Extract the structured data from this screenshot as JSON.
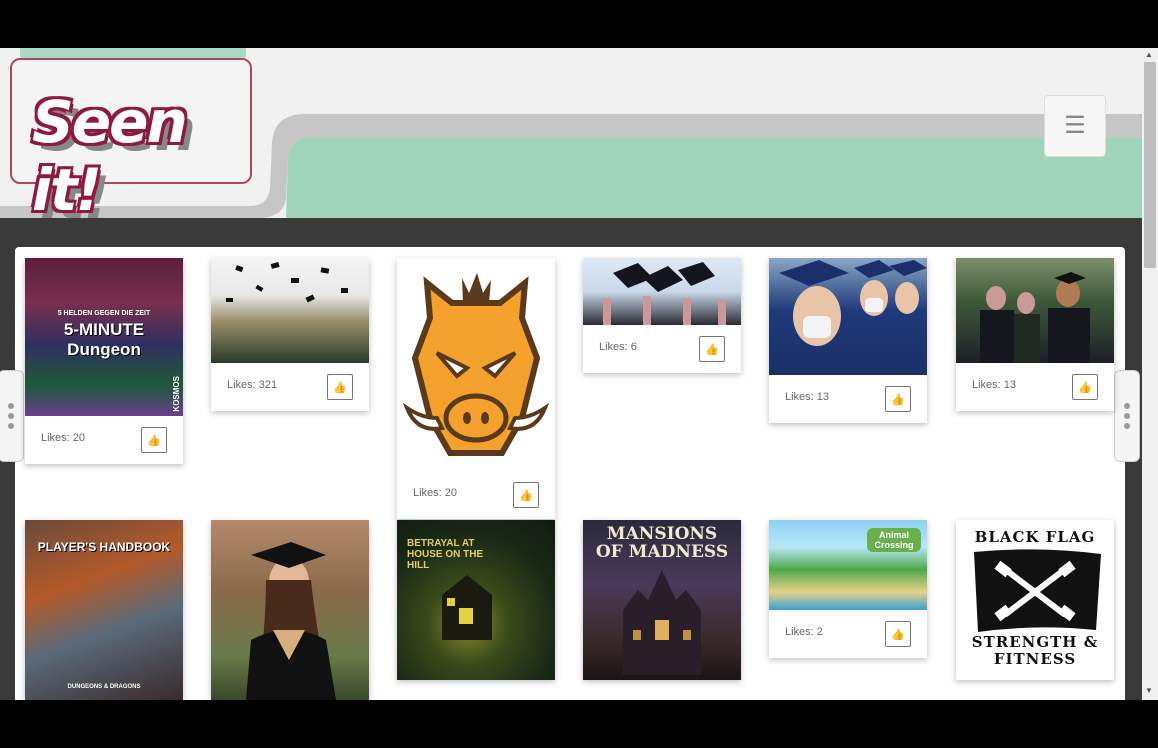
{
  "logo": {
    "text": "Seen it!"
  },
  "header": {
    "menu_icon": "hamburger-icon",
    "menu_glyph": "☰"
  },
  "colors": {
    "mint": "#9fd4b9",
    "stripe": "#c6c6c6",
    "dark": "#3a3a3a",
    "logo_border": "#b04a5a"
  },
  "cards": [
    {
      "name": "five-minute-dungeon",
      "likes": "Likes: 20",
      "caption": "5-MINUTE Dungeon",
      "sub": "KOSMOS",
      "header_text": "5 HELDEN GEGEN DIE ZEIT"
    },
    {
      "name": "graduation-caps-toss",
      "likes": "Likes: 321"
    },
    {
      "name": "grunt-boar-logo",
      "likes": "Likes: 20"
    },
    {
      "name": "graduation-hands-caps",
      "likes": "Likes: 6"
    },
    {
      "name": "graduates-masks",
      "likes": "Likes: 13"
    },
    {
      "name": "graduates-thumbs-up",
      "likes": "Likes: 13"
    },
    {
      "name": "players-handbook",
      "caption": "PLAYER'S HANDBOOK",
      "sub": "DUNGEONS & DRAGONS"
    },
    {
      "name": "graduate-portrait"
    },
    {
      "name": "betrayal-house-on-the-hill",
      "caption": "BETRAYAL AT HOUSE ON THE HILL"
    },
    {
      "name": "mansions-of-madness",
      "caption": "MANSIONS OF MADNESS"
    },
    {
      "name": "animal-crossing",
      "likes": "Likes: 2",
      "caption": "Animal Crossing"
    },
    {
      "name": "black-flag-fitness",
      "caption": "BLACK FLAG",
      "sub": "STRENGTH & FITNESS"
    }
  ],
  "like_icon": "thumbs-up-icon",
  "like_glyph": "👍"
}
